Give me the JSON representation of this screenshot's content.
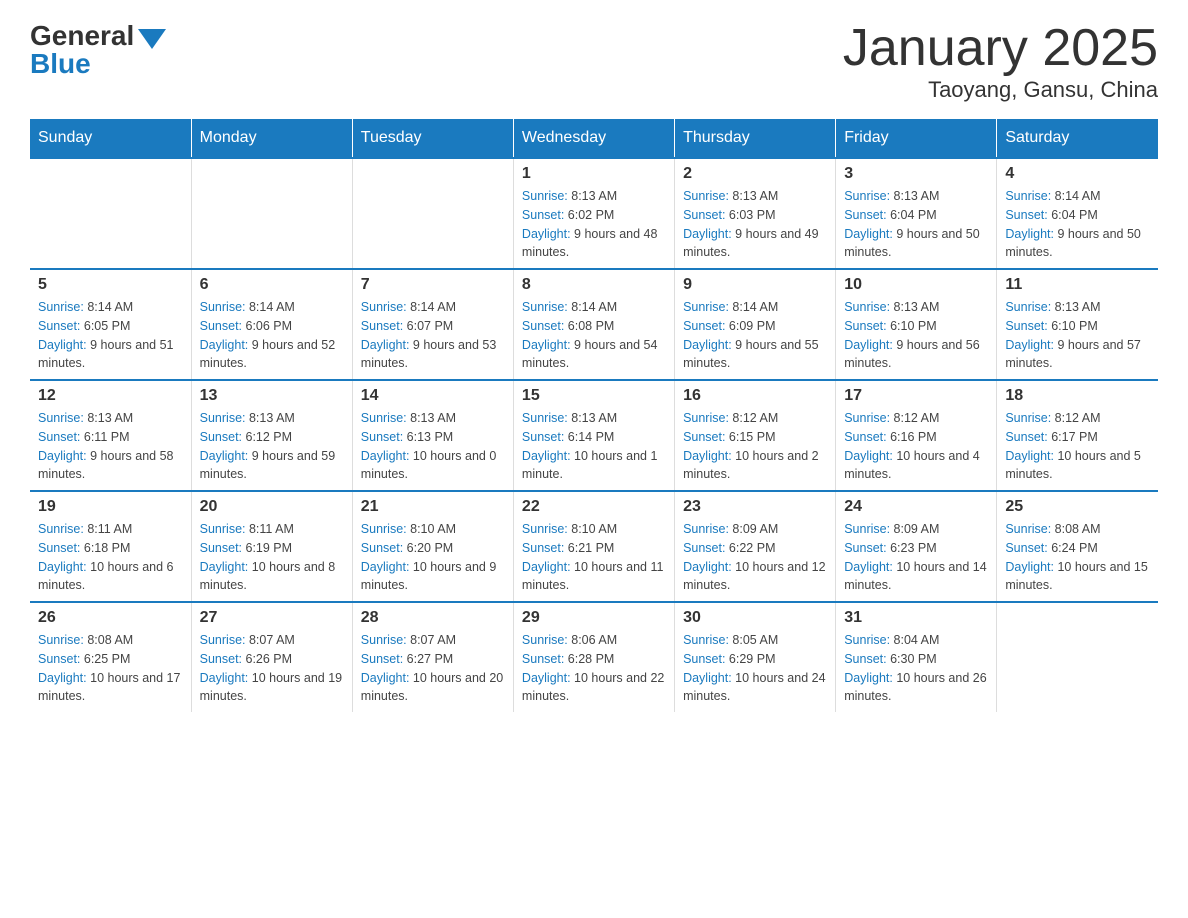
{
  "header": {
    "logo_general": "General",
    "logo_blue": "Blue",
    "title": "January 2025",
    "subtitle": "Taoyang, Gansu, China"
  },
  "days_of_week": [
    "Sunday",
    "Monday",
    "Tuesday",
    "Wednesday",
    "Thursday",
    "Friday",
    "Saturday"
  ],
  "weeks": [
    {
      "days": [
        {
          "num": "",
          "sunrise": "",
          "sunset": "",
          "daylight": ""
        },
        {
          "num": "",
          "sunrise": "",
          "sunset": "",
          "daylight": ""
        },
        {
          "num": "",
          "sunrise": "",
          "sunset": "",
          "daylight": ""
        },
        {
          "num": "1",
          "sunrise": "8:13 AM",
          "sunset": "6:02 PM",
          "daylight": "9 hours and 48 minutes."
        },
        {
          "num": "2",
          "sunrise": "8:13 AM",
          "sunset": "6:03 PM",
          "daylight": "9 hours and 49 minutes."
        },
        {
          "num": "3",
          "sunrise": "8:13 AM",
          "sunset": "6:04 PM",
          "daylight": "9 hours and 50 minutes."
        },
        {
          "num": "4",
          "sunrise": "8:14 AM",
          "sunset": "6:04 PM",
          "daylight": "9 hours and 50 minutes."
        }
      ]
    },
    {
      "days": [
        {
          "num": "5",
          "sunrise": "8:14 AM",
          "sunset": "6:05 PM",
          "daylight": "9 hours and 51 minutes."
        },
        {
          "num": "6",
          "sunrise": "8:14 AM",
          "sunset": "6:06 PM",
          "daylight": "9 hours and 52 minutes."
        },
        {
          "num": "7",
          "sunrise": "8:14 AM",
          "sunset": "6:07 PM",
          "daylight": "9 hours and 53 minutes."
        },
        {
          "num": "8",
          "sunrise": "8:14 AM",
          "sunset": "6:08 PM",
          "daylight": "9 hours and 54 minutes."
        },
        {
          "num": "9",
          "sunrise": "8:14 AM",
          "sunset": "6:09 PM",
          "daylight": "9 hours and 55 minutes."
        },
        {
          "num": "10",
          "sunrise": "8:13 AM",
          "sunset": "6:10 PM",
          "daylight": "9 hours and 56 minutes."
        },
        {
          "num": "11",
          "sunrise": "8:13 AM",
          "sunset": "6:10 PM",
          "daylight": "9 hours and 57 minutes."
        }
      ]
    },
    {
      "days": [
        {
          "num": "12",
          "sunrise": "8:13 AM",
          "sunset": "6:11 PM",
          "daylight": "9 hours and 58 minutes."
        },
        {
          "num": "13",
          "sunrise": "8:13 AM",
          "sunset": "6:12 PM",
          "daylight": "9 hours and 59 minutes."
        },
        {
          "num": "14",
          "sunrise": "8:13 AM",
          "sunset": "6:13 PM",
          "daylight": "10 hours and 0 minutes."
        },
        {
          "num": "15",
          "sunrise": "8:13 AM",
          "sunset": "6:14 PM",
          "daylight": "10 hours and 1 minute."
        },
        {
          "num": "16",
          "sunrise": "8:12 AM",
          "sunset": "6:15 PM",
          "daylight": "10 hours and 2 minutes."
        },
        {
          "num": "17",
          "sunrise": "8:12 AM",
          "sunset": "6:16 PM",
          "daylight": "10 hours and 4 minutes."
        },
        {
          "num": "18",
          "sunrise": "8:12 AM",
          "sunset": "6:17 PM",
          "daylight": "10 hours and 5 minutes."
        }
      ]
    },
    {
      "days": [
        {
          "num": "19",
          "sunrise": "8:11 AM",
          "sunset": "6:18 PM",
          "daylight": "10 hours and 6 minutes."
        },
        {
          "num": "20",
          "sunrise": "8:11 AM",
          "sunset": "6:19 PM",
          "daylight": "10 hours and 8 minutes."
        },
        {
          "num": "21",
          "sunrise": "8:10 AM",
          "sunset": "6:20 PM",
          "daylight": "10 hours and 9 minutes."
        },
        {
          "num": "22",
          "sunrise": "8:10 AM",
          "sunset": "6:21 PM",
          "daylight": "10 hours and 11 minutes."
        },
        {
          "num": "23",
          "sunrise": "8:09 AM",
          "sunset": "6:22 PM",
          "daylight": "10 hours and 12 minutes."
        },
        {
          "num": "24",
          "sunrise": "8:09 AM",
          "sunset": "6:23 PM",
          "daylight": "10 hours and 14 minutes."
        },
        {
          "num": "25",
          "sunrise": "8:08 AM",
          "sunset": "6:24 PM",
          "daylight": "10 hours and 15 minutes."
        }
      ]
    },
    {
      "days": [
        {
          "num": "26",
          "sunrise": "8:08 AM",
          "sunset": "6:25 PM",
          "daylight": "10 hours and 17 minutes."
        },
        {
          "num": "27",
          "sunrise": "8:07 AM",
          "sunset": "6:26 PM",
          "daylight": "10 hours and 19 minutes."
        },
        {
          "num": "28",
          "sunrise": "8:07 AM",
          "sunset": "6:27 PM",
          "daylight": "10 hours and 20 minutes."
        },
        {
          "num": "29",
          "sunrise": "8:06 AM",
          "sunset": "6:28 PM",
          "daylight": "10 hours and 22 minutes."
        },
        {
          "num": "30",
          "sunrise": "8:05 AM",
          "sunset": "6:29 PM",
          "daylight": "10 hours and 24 minutes."
        },
        {
          "num": "31",
          "sunrise": "8:04 AM",
          "sunset": "6:30 PM",
          "daylight": "10 hours and 26 minutes."
        },
        {
          "num": "",
          "sunrise": "",
          "sunset": "",
          "daylight": ""
        }
      ]
    }
  ]
}
